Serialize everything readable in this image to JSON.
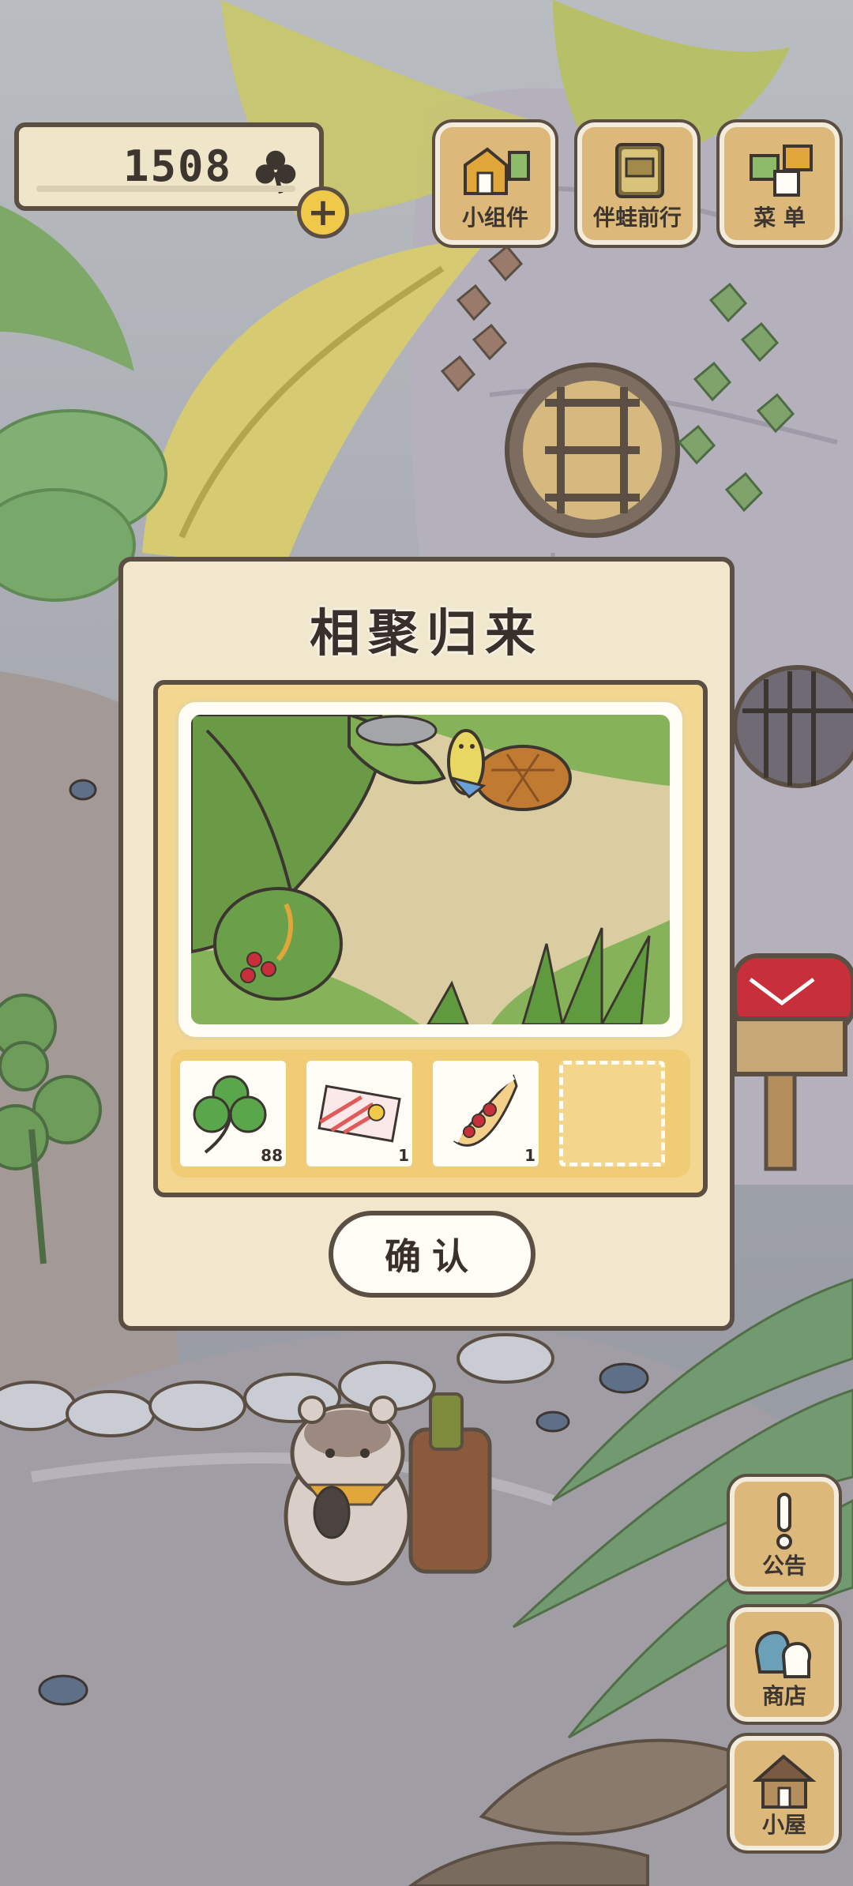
{
  "hud": {
    "clover_count": "1508",
    "top_buttons": [
      {
        "label": "小组件",
        "icon": "widget-icon"
      },
      {
        "label": "伴蛙前行",
        "icon": "journal-icon"
      },
      {
        "label": "菜 单",
        "icon": "menu-icon"
      }
    ],
    "side_buttons": [
      {
        "label": "公告",
        "icon": "exclamation-icon"
      },
      {
        "label": "商店",
        "icon": "shop-bags-icon"
      },
      {
        "label": "小屋",
        "icon": "house-icon"
      }
    ]
  },
  "dialog": {
    "title": "相聚归来",
    "items": [
      {
        "name": "clover",
        "qty": "88",
        "icon": "clover-icon"
      },
      {
        "name": "ticket",
        "qty": "1",
        "icon": "ticket-icon"
      },
      {
        "name": "crepe",
        "qty": "1",
        "icon": "crepe-icon"
      }
    ],
    "confirm_label": "确认"
  },
  "colors": {
    "panel_cream": "#f0e7cc",
    "panel_gold": "#f3d68f",
    "outline": "#5b4f44",
    "button_wood": "#dcb97a"
  }
}
